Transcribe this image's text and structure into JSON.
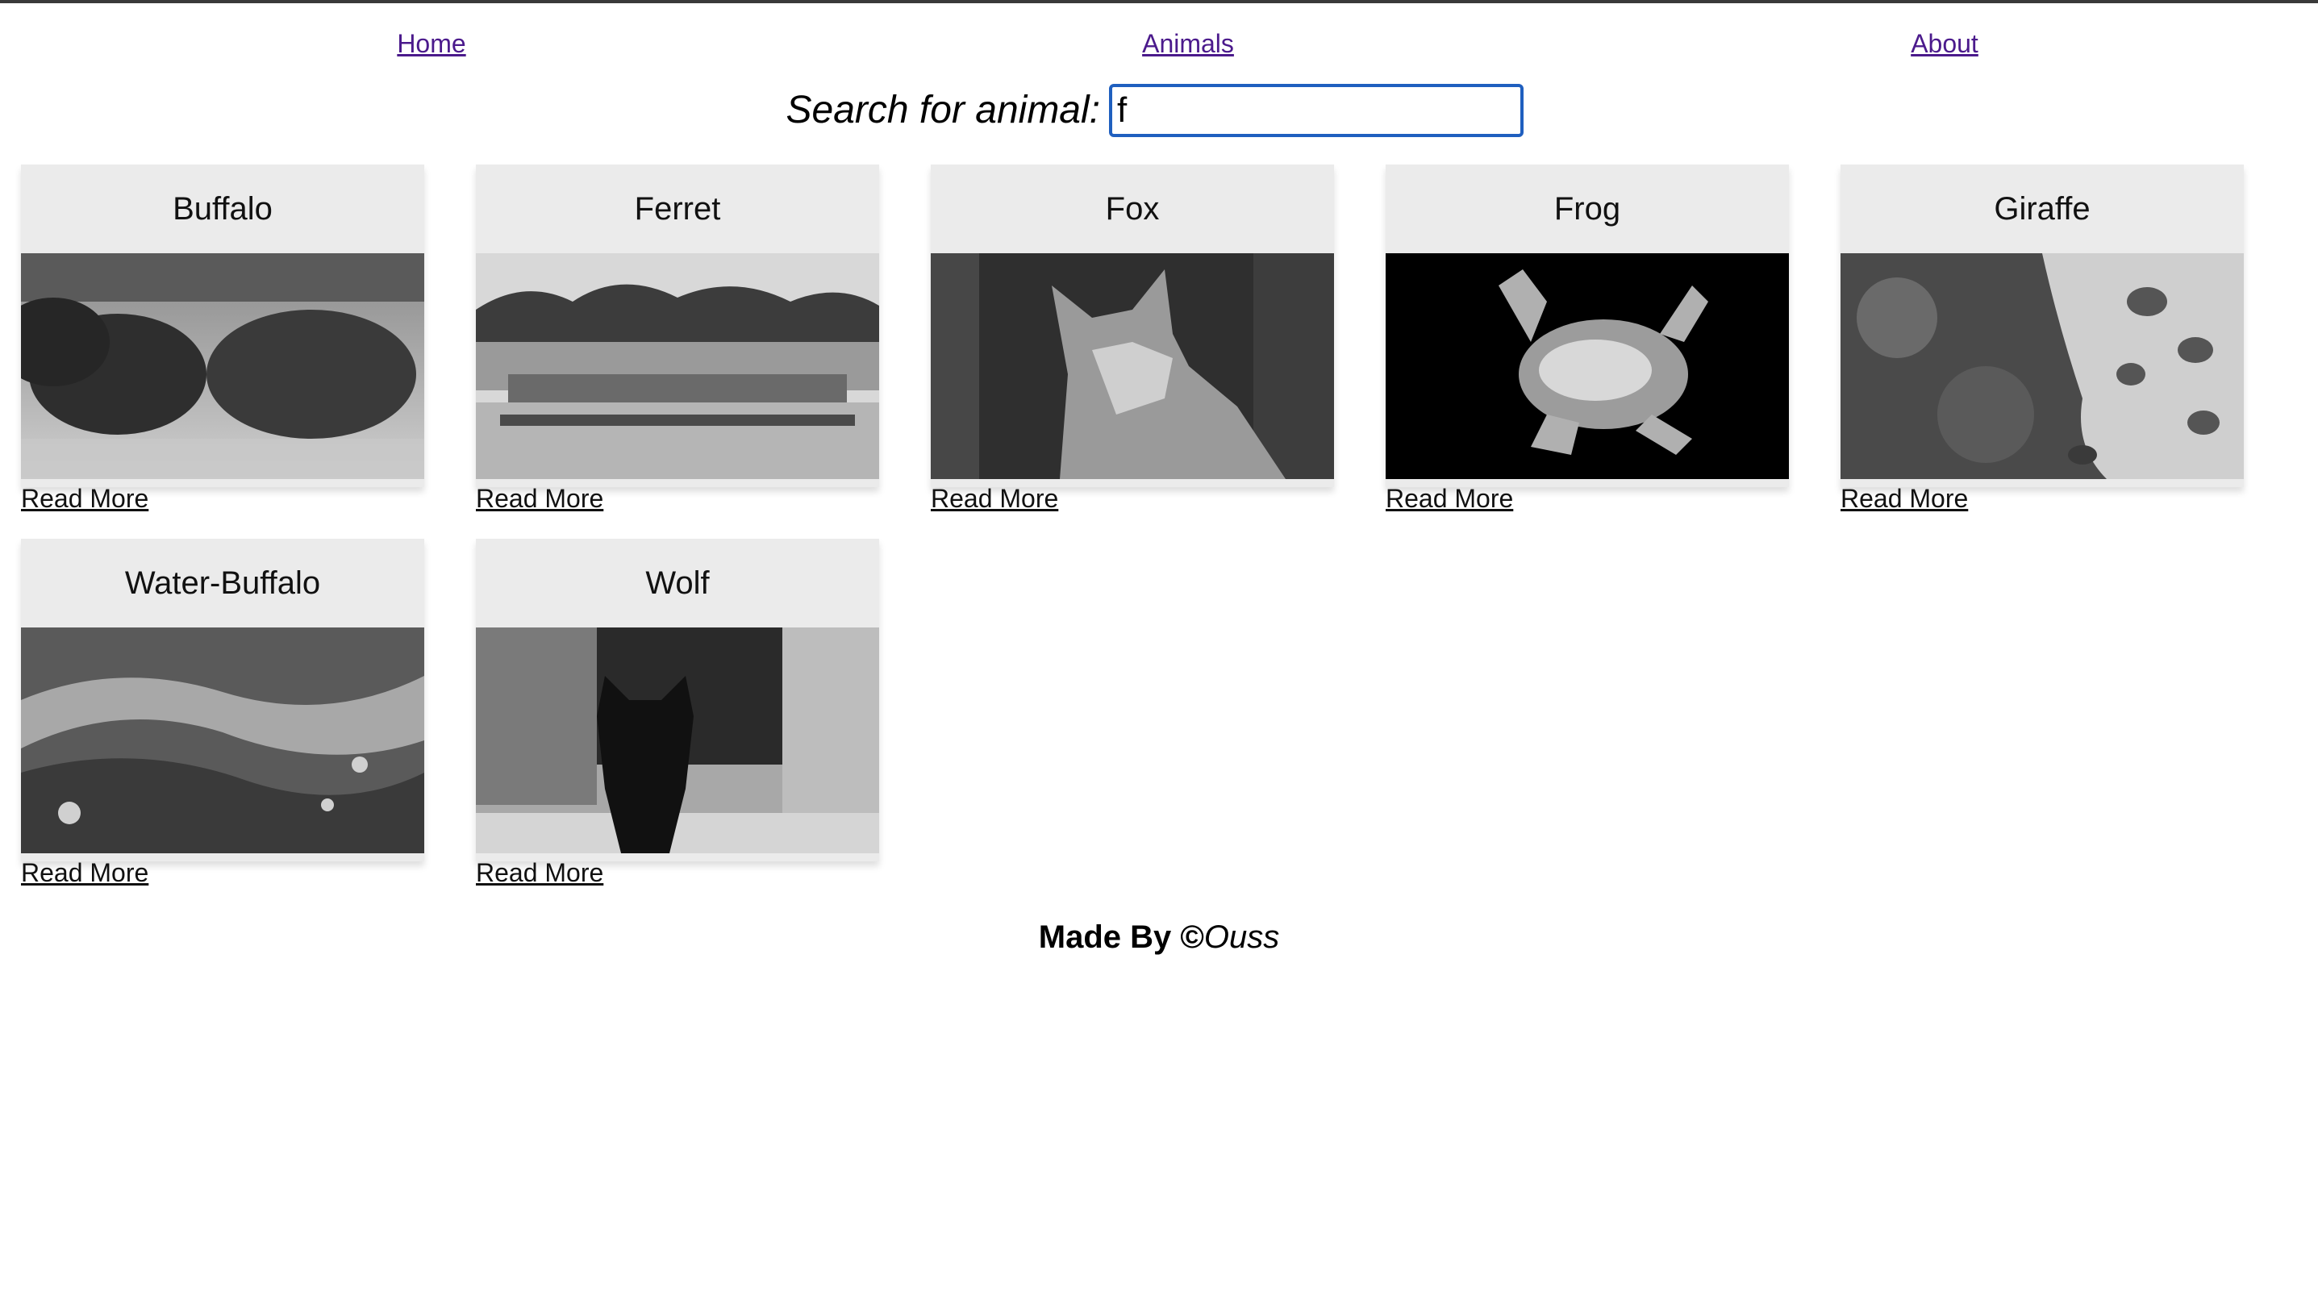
{
  "nav": {
    "items": [
      {
        "label": "Home"
      },
      {
        "label": "Animals"
      },
      {
        "label": "About"
      }
    ]
  },
  "search": {
    "label": "Search for animal:",
    "value": "f"
  },
  "cards": [
    {
      "title": "Buffalo",
      "link": "Read More",
      "image": "buffalo-photo"
    },
    {
      "title": "Ferret",
      "link": "Read More",
      "image": "harbor-boat-photo"
    },
    {
      "title": "Fox",
      "link": "Read More",
      "image": "fox-photo"
    },
    {
      "title": "Frog",
      "link": "Read More",
      "image": "glass-frog-photo"
    },
    {
      "title": "Giraffe",
      "link": "Read More",
      "image": "giraffe-photo"
    },
    {
      "title": "Water-Buffalo",
      "link": "Read More",
      "image": "water-splash-photo"
    },
    {
      "title": "Wolf",
      "link": "Read More",
      "image": "black-wolf-photo"
    }
  ],
  "footer": {
    "prefix": "Made By ©",
    "author": "Ouss"
  },
  "colors": {
    "link": "#4b1a8c",
    "card_bg": "#ebebeb",
    "input_border": "#1f5fbf"
  }
}
